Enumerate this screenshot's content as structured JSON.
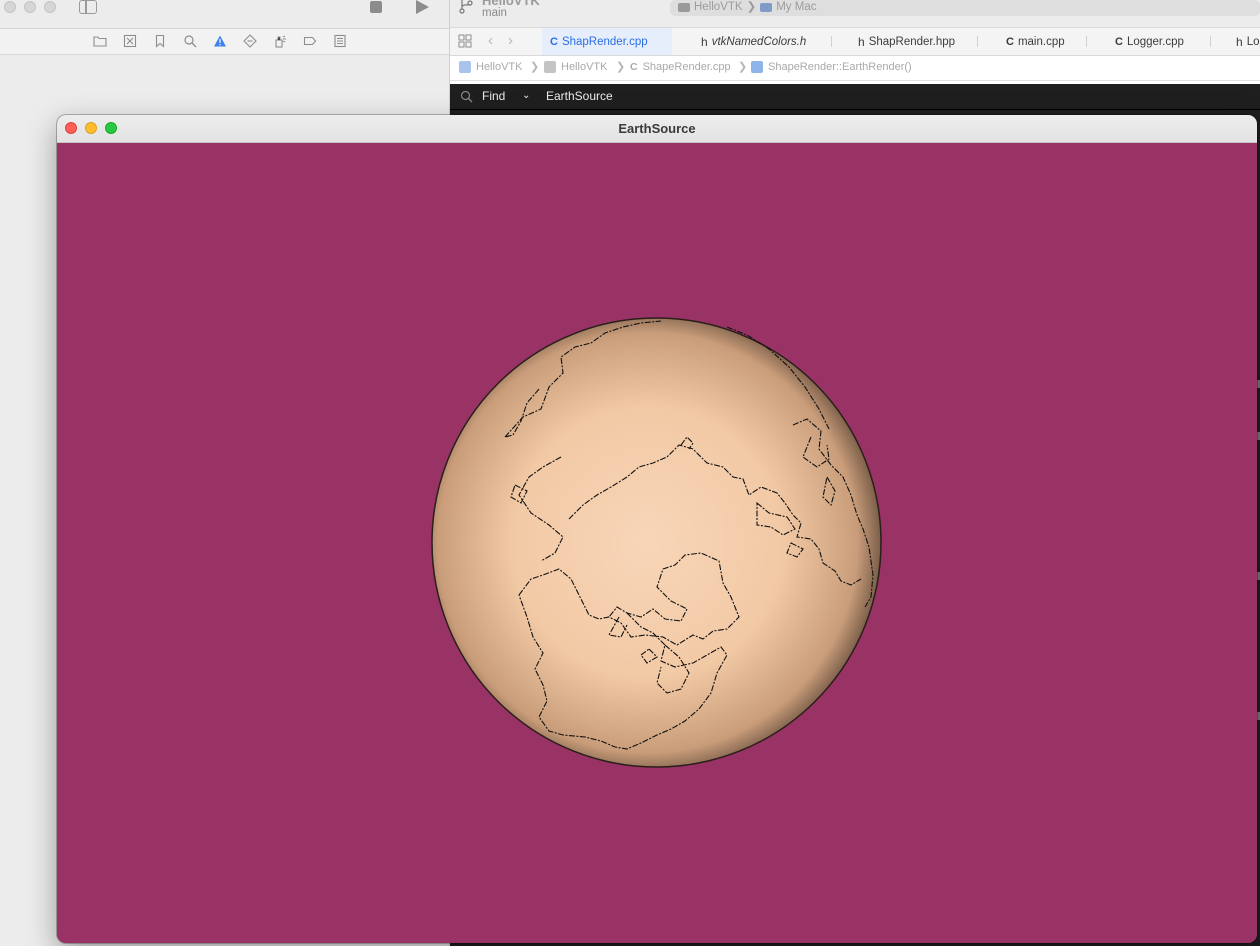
{
  "xcode": {
    "project_name": "HelloVTK",
    "branch": "main",
    "scheme": {
      "project": "HelloVTK",
      "destination": "My Mac"
    },
    "tabs": [
      {
        "mark": "C",
        "label": "ShapRender.cpp",
        "active": true
      },
      {
        "mark": "h",
        "label": "vtkNamedColors.h",
        "active": false
      },
      {
        "mark": "h",
        "label": "ShapRender.hpp",
        "active": false
      },
      {
        "mark": "C",
        "label": "main.cpp",
        "active": false
      },
      {
        "mark": "C",
        "label": "Logger.cpp",
        "active": false
      },
      {
        "mark": "h",
        "label": "Lo",
        "active": false
      }
    ],
    "breadcrumbs": [
      "HelloVTK",
      "HelloVTK",
      "ShapeRender.cpp",
      "ShapeRender::EarthRender()"
    ],
    "crumb_separator": "❯",
    "find": {
      "mode": "Find",
      "query": "EarthSource"
    },
    "accent_color": "#2a6ee8"
  },
  "vtk_window": {
    "title": "EarthSource",
    "background_color": "#993366",
    "globe_color": "#f8d6b8",
    "outline_color": "#111111"
  }
}
